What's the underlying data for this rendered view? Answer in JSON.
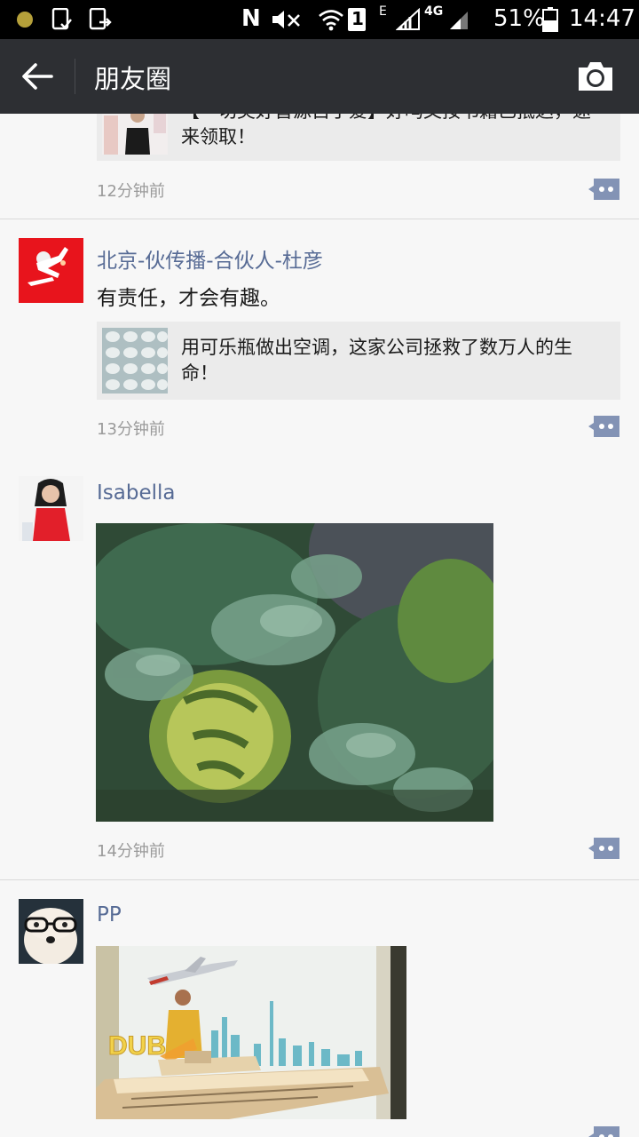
{
  "status_bar": {
    "battery_percent": "51%",
    "time": "14:47",
    "network_label": "4G",
    "sim_label": "1",
    "network_type": "E",
    "nfc_label": "N"
  },
  "app_bar": {
    "title": "朋友圈"
  },
  "posts": [
    {
      "link_title": "【一切美好皆源自于爱】好吗文按书籍已抵达，速来领取！",
      "time": "12分钟前"
    },
    {
      "name": "北京-伙传播-合伙人-杜彦",
      "text": "有责任，才会有趣。",
      "link_title": "用可乐瓶做出空调，这家公司拯救了数万人的生命！",
      "time": "13分钟前"
    },
    {
      "name": "Isabella",
      "time": "14分钟前"
    },
    {
      "name": "PP",
      "photo_text": "DUBAI"
    }
  ],
  "colors": {
    "name_blue": "#576b95",
    "app_bar_bg": "#2d2f33",
    "link_bg": "#ebebeb"
  },
  "icons": [
    "back-arrow-icon",
    "camera-icon",
    "comment-icon"
  ]
}
